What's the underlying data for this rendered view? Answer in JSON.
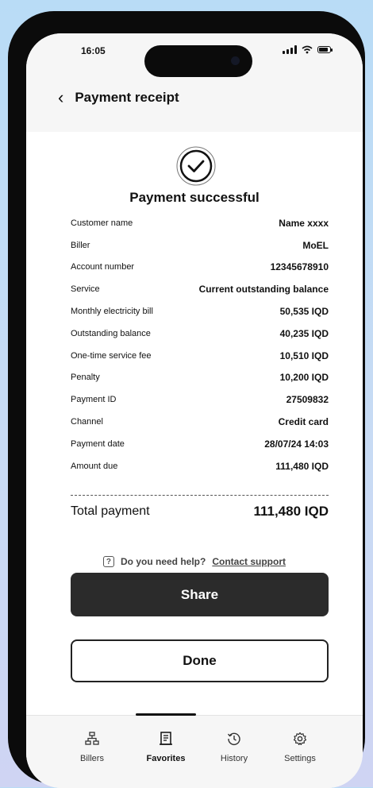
{
  "status_bar": {
    "time": "16:05"
  },
  "header": {
    "title": "Payment receipt",
    "back_icon": "chevron-left-icon"
  },
  "receipt": {
    "status_title": "Payment successful",
    "rows": [
      {
        "label": "Customer name",
        "value": "Name xxxx"
      },
      {
        "label": "Biller",
        "value": "MoEL"
      },
      {
        "label": "Account number",
        "value": "12345678910"
      },
      {
        "label": "Service",
        "value": "Current outstanding balance"
      },
      {
        "label": "Monthly electricity bill",
        "value": "50,535 IQD"
      },
      {
        "label": "Outstanding balance",
        "value": "40,235 IQD"
      },
      {
        "label": "One-time service fee",
        "value": "10,510 IQD"
      },
      {
        "label": "Penalty",
        "value": "10,200 IQD"
      },
      {
        "label": "Payment ID",
        "value": "27509832"
      },
      {
        "label": "Channel",
        "value": "Credit card"
      },
      {
        "label": "Payment date",
        "value": "28/07/24 14:03"
      },
      {
        "label": "Amount due",
        "value": "111,480 IQD"
      }
    ],
    "total_label": "Total payment",
    "total_value": "111,480 IQD"
  },
  "help": {
    "text": "Do you need help?",
    "link": "Contact support"
  },
  "actions": {
    "share_label": "Share",
    "done_label": "Done"
  },
  "tabbar": {
    "tabs": [
      {
        "label": "Billers",
        "icon": "sitemap-icon"
      },
      {
        "label": "Favorites",
        "icon": "receipt-icon",
        "active": true
      },
      {
        "label": "History",
        "icon": "history-icon"
      },
      {
        "label": "Settings",
        "icon": "gear-icon"
      }
    ]
  },
  "colors": {
    "primary_button": "#2b2b2b",
    "background": "#b9dcf6"
  }
}
